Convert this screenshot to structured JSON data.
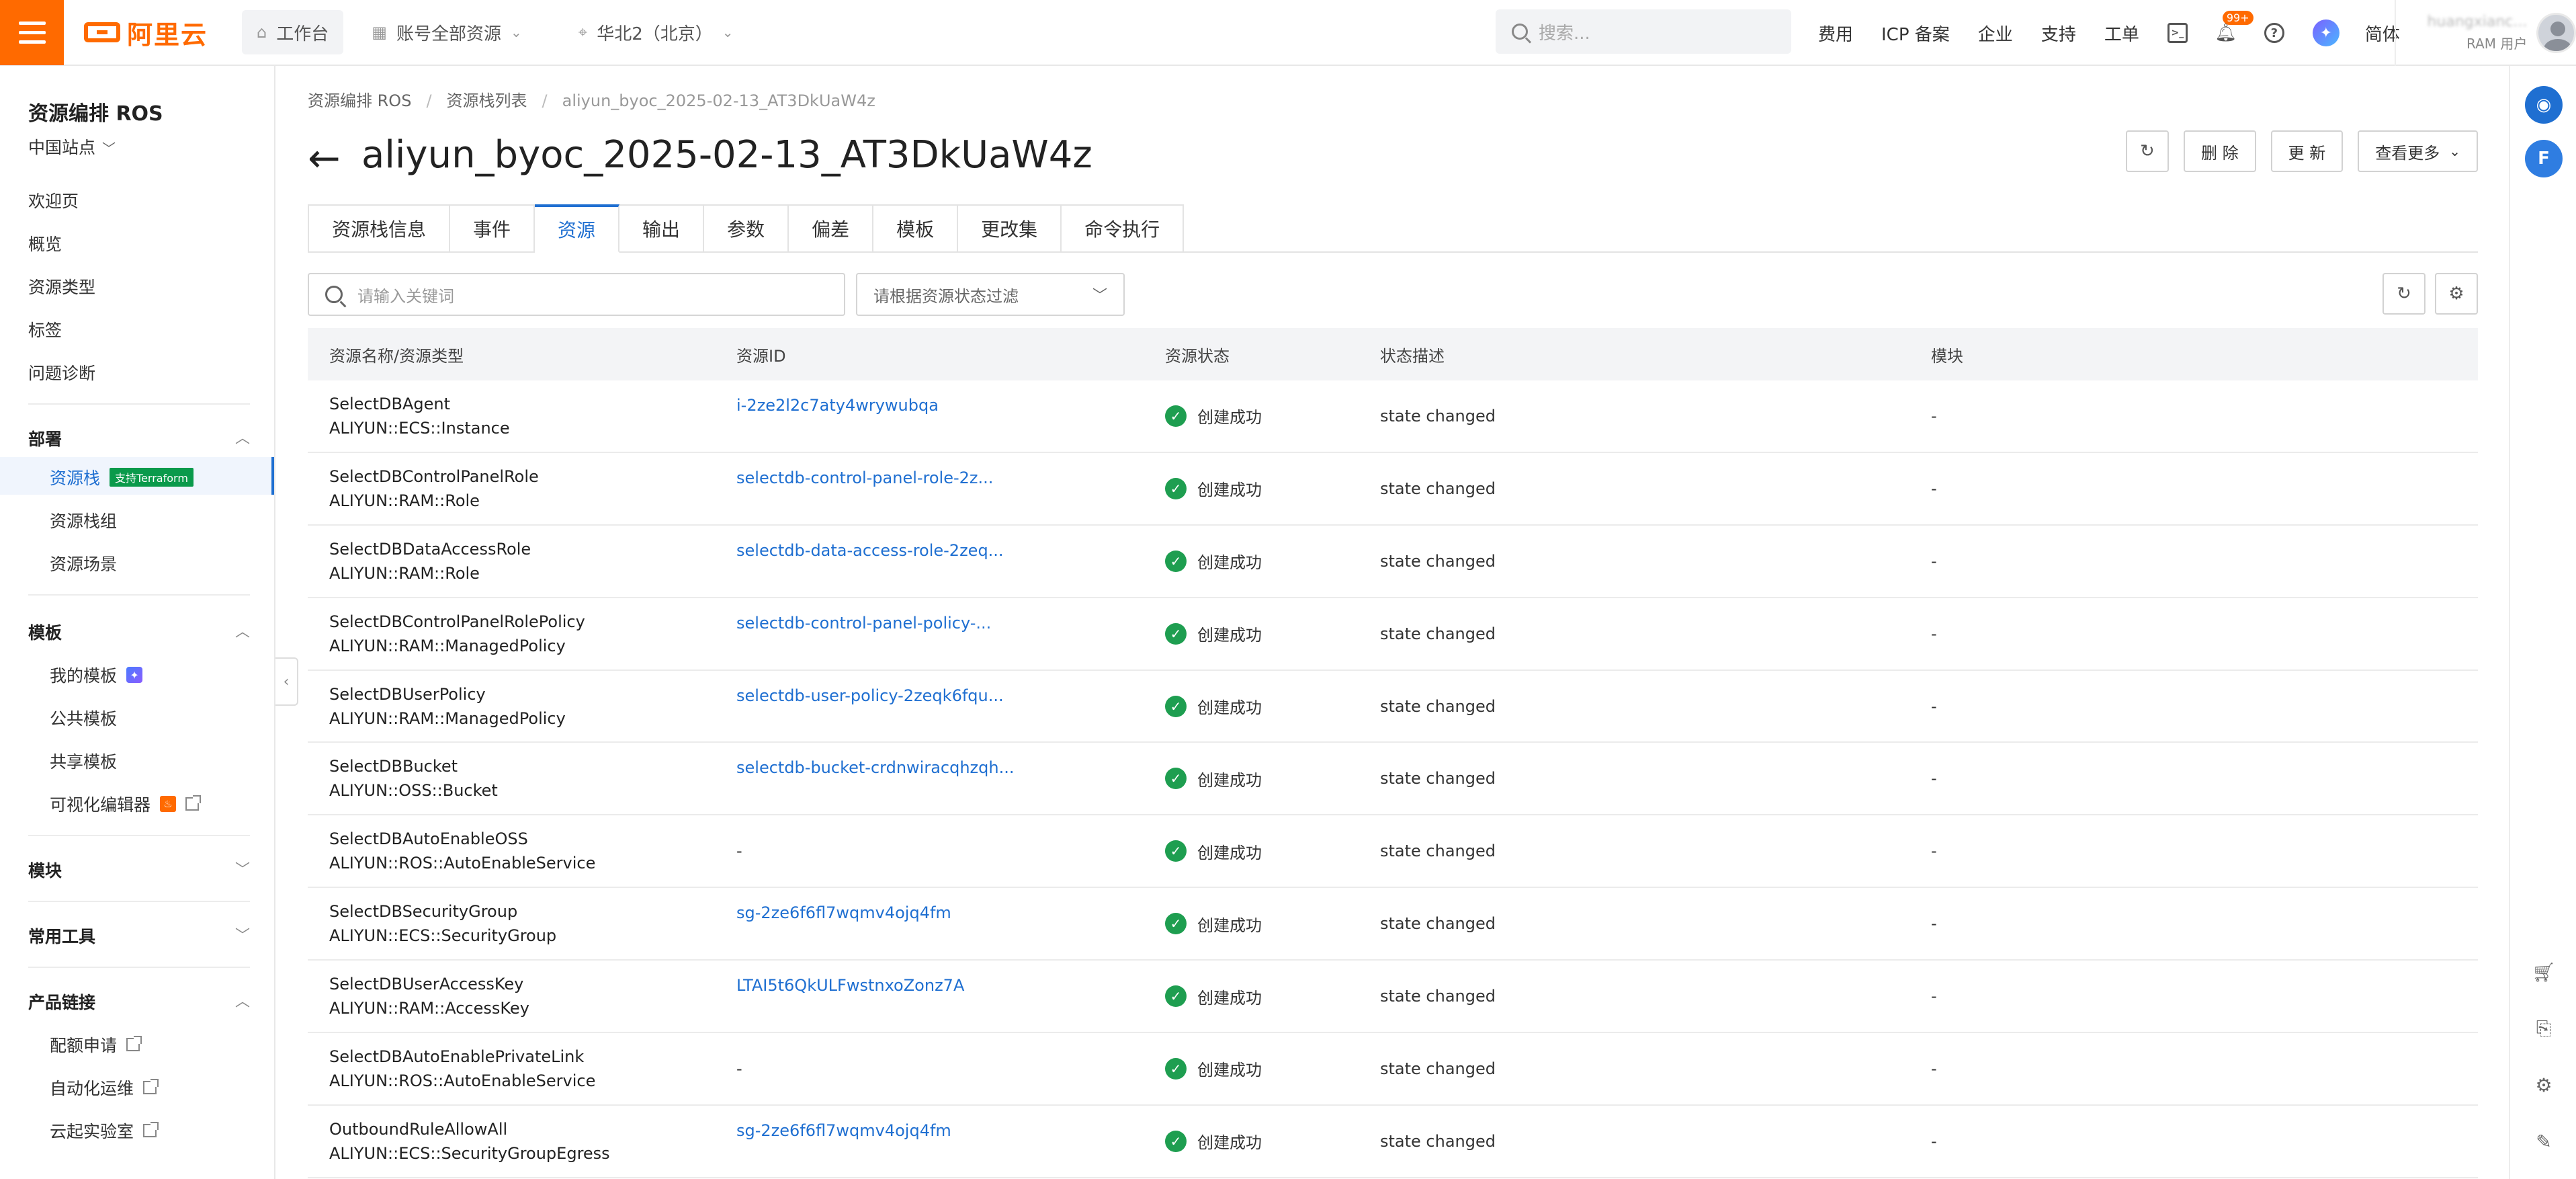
{
  "topbar": {
    "logo_text": "阿里云",
    "workbench": "工作台",
    "account_scope": "账号全部资源",
    "region": "华北2（北京）",
    "search_placeholder": "搜索...",
    "links": [
      "费用",
      "ICP 备案",
      "企业",
      "支持",
      "工单"
    ],
    "notification_badge": "99+",
    "language": "简体",
    "user_name": "huangxianc...",
    "user_role": "RAM 用户"
  },
  "sidebar": {
    "title": "资源编排 ROS",
    "site": "中国站点",
    "top_links": [
      "欢迎页",
      "概览",
      "资源类型",
      "标签",
      "问题诊断"
    ],
    "groups": {
      "deploy": {
        "label": "部署",
        "items": [
          "资源栈",
          "资源栈组",
          "资源场景"
        ],
        "terraform_tag": "支持Terraform"
      },
      "template": {
        "label": "模板",
        "items": [
          "我的模板",
          "公共模板",
          "共享模板",
          "可视化编辑器"
        ]
      },
      "module": {
        "label": "模块"
      },
      "tools": {
        "label": "常用工具"
      },
      "product_links": {
        "label": "产品链接",
        "items": [
          "配额申请",
          "自动化运维",
          "云起实验室"
        ]
      }
    }
  },
  "breadcrumb": [
    "资源编排 ROS",
    "资源栈列表",
    "aliyun_byoc_2025-02-13_AT3DkUaW4z"
  ],
  "page_title": "aliyun_byoc_2025-02-13_AT3DkUaW4z",
  "actions": {
    "delete": "删 除",
    "update": "更 新",
    "more": "查看更多"
  },
  "tabs": [
    "资源栈信息",
    "事件",
    "资源",
    "输出",
    "参数",
    "偏差",
    "模板",
    "更改集",
    "命令执行"
  ],
  "active_tab": "资源",
  "filters": {
    "keyword_placeholder": "请输入关键词",
    "status_placeholder": "请根据资源状态过滤"
  },
  "table": {
    "columns": [
      "资源名称/资源类型",
      "资源ID",
      "资源状态",
      "状态描述",
      "模块"
    ],
    "rows": [
      {
        "name": "SelectDBAgent",
        "type": "ALIYUN::ECS::Instance",
        "id": "i-2ze2l2c7aty4wrywubqa",
        "status": "创建成功",
        "desc": "state changed",
        "module": "-"
      },
      {
        "name": "SelectDBControlPanelRole",
        "type": "ALIYUN::RAM::Role",
        "id": "selectdb-control-panel-role-2z...",
        "status": "创建成功",
        "desc": "state changed",
        "module": "-"
      },
      {
        "name": "SelectDBDataAccessRole",
        "type": "ALIYUN::RAM::Role",
        "id": "selectdb-data-access-role-2zeq...",
        "status": "创建成功",
        "desc": "state changed",
        "module": "-"
      },
      {
        "name": "SelectDBControlPanelRolePolicy",
        "type": "ALIYUN::RAM::ManagedPolicy",
        "id": "selectdb-control-panel-policy-...",
        "status": "创建成功",
        "desc": "state changed",
        "module": "-"
      },
      {
        "name": "SelectDBUserPolicy",
        "type": "ALIYUN::RAM::ManagedPolicy",
        "id": "selectdb-user-policy-2zeqk6fqu...",
        "status": "创建成功",
        "desc": "state changed",
        "module": "-"
      },
      {
        "name": "SelectDBBucket",
        "type": "ALIYUN::OSS::Bucket",
        "id": "selectdb-bucket-crdnwiracqhzqh...",
        "status": "创建成功",
        "desc": "state changed",
        "module": "-"
      },
      {
        "name": "SelectDBAutoEnableOSS",
        "type": "ALIYUN::ROS::AutoEnableService",
        "id": "-",
        "status": "创建成功",
        "desc": "state changed",
        "module": "-"
      },
      {
        "name": "SelectDBSecurityGroup",
        "type": "ALIYUN::ECS::SecurityGroup",
        "id": "sg-2ze6f6fl7wqmv4ojq4fm",
        "status": "创建成功",
        "desc": "state changed",
        "module": "-"
      },
      {
        "name": "SelectDBUserAccessKey",
        "type": "ALIYUN::RAM::AccessKey",
        "id": "LTAI5t6QkULFwstnxoZonz7A",
        "status": "创建成功",
        "desc": "state changed",
        "module": "-"
      },
      {
        "name": "SelectDBAutoEnablePrivateLink",
        "type": "ALIYUN::ROS::AutoEnableService",
        "id": "-",
        "status": "创建成功",
        "desc": "state changed",
        "module": "-"
      },
      {
        "name": "OutboundRuleAllowAll",
        "type": "ALIYUN::ECS::SecurityGroupEgress",
        "id": "sg-2ze6f6fl7wqmv4ojq4fm",
        "status": "创建成功",
        "desc": "state changed",
        "module": "-"
      }
    ]
  },
  "colors": {
    "brand": "#ff6a00",
    "link": "#1f6fd1",
    "success": "#1e9e50",
    "terraform_tag": "#0a9a4b"
  }
}
